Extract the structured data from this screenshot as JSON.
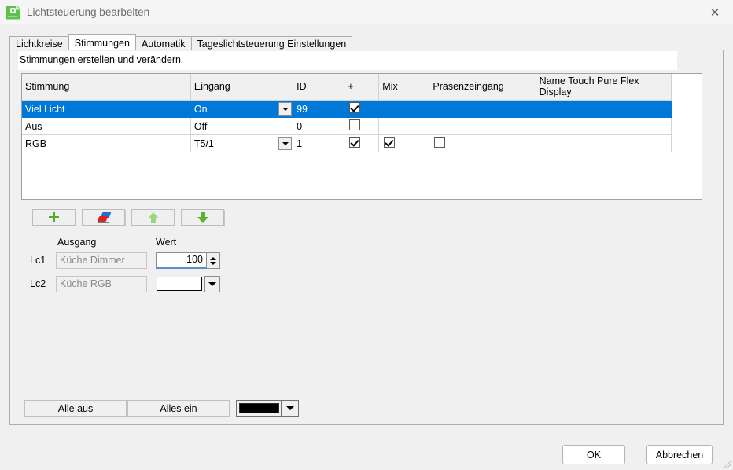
{
  "window": {
    "title": "Lichtsteuerung bearbeiten",
    "icon": "document-gear-icon",
    "icon_brand": "COMPRO",
    "close_label": "✕",
    "accent_color": "#0078d7",
    "background_color": "#f0f0f0"
  },
  "tabs": [
    {
      "label": "Lichtkreise",
      "selected": false
    },
    {
      "label": "Stimmungen",
      "selected": true
    },
    {
      "label": "Automatik",
      "selected": false
    },
    {
      "label": "Tageslichtsteuerung Einstellungen",
      "selected": false
    }
  ],
  "banner": {
    "text": "Stimmungen erstellen und verändern"
  },
  "grid": {
    "columns": [
      "Stimmung",
      "Eingang",
      "ID",
      "+",
      "Mix",
      "Präsenzeingang",
      "Name Touch Pure Flex Display"
    ],
    "rows": [
      {
        "selected": true,
        "stimmung": "Viel Licht",
        "eingang": "On",
        "eingang_has_dropdown": true,
        "id": "99",
        "plus": "checked",
        "mix": "none",
        "praesenzeingang": "none",
        "name_touch_pure": ""
      },
      {
        "selected": false,
        "stimmung": "Aus",
        "eingang": "Off",
        "eingang_has_dropdown": false,
        "id": "0",
        "plus": "unchecked",
        "mix": "none",
        "praesenzeingang": "none",
        "name_touch_pure": ""
      },
      {
        "selected": false,
        "stimmung": "RGB",
        "eingang": "T5/1",
        "eingang_has_dropdown": true,
        "id": "1",
        "plus": "checked",
        "mix": "checked",
        "praesenzeingang": "unchecked",
        "name_touch_pure": ""
      }
    ]
  },
  "toolbar": {
    "add": {
      "icon": "plus-icon",
      "label": ""
    },
    "delete": {
      "icon": "eraser-icon",
      "label": ""
    },
    "move_up": {
      "icon": "arrow-up-icon",
      "label": ""
    },
    "move_down": {
      "icon": "arrow-down-icon",
      "label": ""
    }
  },
  "outputs": {
    "header_ausgang": "Ausgang",
    "header_wert": "Wert",
    "rows": [
      {
        "label": "Lc1",
        "ausgang": "Küche Dimmer",
        "control": "spinner",
        "wert": "100"
      },
      {
        "label": "Lc2",
        "ausgang": "Küche RGB",
        "control": "combobox",
        "wert": ""
      }
    ]
  },
  "bottom_actions": {
    "all_off_label": "Alle aus",
    "all_on_label": "Alles ein",
    "color_value": "#000000"
  },
  "footer": {
    "ok_label": "OK",
    "cancel_label": "Abbrechen"
  }
}
